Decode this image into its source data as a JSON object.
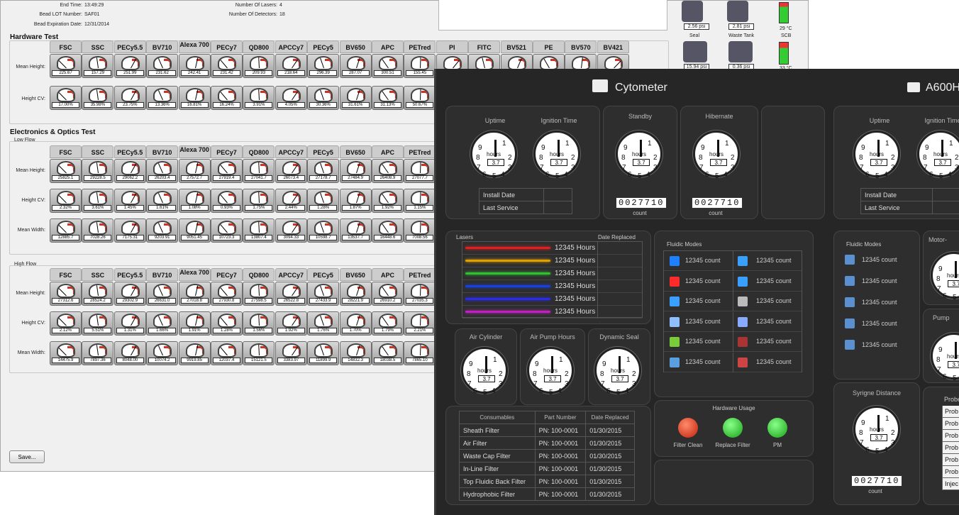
{
  "top": {
    "end_time_label": "End Time:",
    "end_time": "13:49:29",
    "bead_lot_label": "Bead LOT Number:",
    "bead_lot": "SAF01",
    "bead_exp_label": "Bead Expiration Date:",
    "bead_exp": "12/31/2014",
    "lasers_label": "Number Of Lasers:",
    "lasers": "4",
    "detectors_label": "Number Of Detectors:",
    "detectors": "18"
  },
  "side": {
    "psi1": "2.56 psi",
    "psi2": "2.81 psi",
    "temp1": "29 °C",
    "seal": "Seal",
    "waste": "Waste Tank",
    "scb": "SCB",
    "psi3": "15.94 psi",
    "psi4": "0.36 psi",
    "temp2": "33 °C"
  },
  "hardware": {
    "title": "Hardware Test",
    "cols": [
      "FSC",
      "SSC",
      "PECy5.5",
      "BV710",
      "Alexa 700",
      "PECy7",
      "QD800",
      "APCCy7",
      "PECy5",
      "BV650",
      "APC",
      "PETred",
      "PI",
      "FITC",
      "BV521",
      "PE",
      "BV570",
      "BV421"
    ],
    "row_labels": [
      "Mean Height:",
      "Height CV:"
    ],
    "mean_height": [
      "225.67",
      "157.29",
      "251.99",
      "231.62",
      "242.41",
      "231.42",
      "209.93",
      "218.64",
      "296.39",
      "287.07",
      "300.51",
      "155.45"
    ],
    "height_cv": [
      "17.00%",
      "35.98%",
      "23.75%",
      "13.36%",
      "16.81%",
      "16.24%",
      "3.91%",
      "4.05%",
      "30.36%",
      "31.61%",
      "31.13%",
      "50.67%"
    ]
  },
  "eo": {
    "title": "Electronics & Optics Test",
    "low_title": "Low Flow",
    "high_title": "High Flow",
    "cols": [
      "FSC",
      "SSC",
      "PECy5.5",
      "BV710",
      "Alexa 700",
      "PECy7",
      "QD800",
      "APCCy7",
      "PECy5",
      "BV650",
      "APC",
      "PETred"
    ],
    "row_labels": [
      "Mean Height:",
      "Height CV:",
      "Mean Width:"
    ],
    "low_mh": [
      "25825.1",
      "29228.5",
      "29062.2",
      "26203.4",
      "27572.7",
      "27919.4",
      "27041.7",
      "26073.4",
      "27178.7",
      "27484.9",
      "26408.9",
      "27077.7"
    ],
    "low_cv": [
      "2.32%",
      "3.61%",
      "1.45%",
      "1.61%",
      "1.08%",
      "0.93%",
      "1.75%",
      "2.44%",
      "1.28%",
      "1.87%",
      "1.92%",
      "1.15%"
    ],
    "low_mw": [
      "12885.7",
      "7028.26",
      "7175.31",
      "9203.91",
      "9051.45",
      "10723.3",
      "13807.4",
      "3094.33",
      "10598.7",
      "13537.7",
      "16448.6",
      "7008.56"
    ],
    "high_mh": [
      "27312.6",
      "28524.2",
      "29302.9",
      "26631.0",
      "27018.8",
      "27930.8",
      "27598.5",
      "26522.8",
      "27433.9",
      "28221.9",
      "26910.2",
      "27035.3"
    ],
    "high_cv": [
      "2.12%",
      "5.51%",
      "1.31%",
      "1.66%",
      "1.91%",
      "1.28%",
      "1.56%",
      "1.92%",
      "1.76%",
      "1.70%",
      "1.79%",
      "2.21%"
    ],
    "high_mw": [
      "14475.9",
      "7897.36",
      "8048.00",
      "10074.2",
      "9919.85",
      "12037.4",
      "15121.5",
      "3383.97",
      "11899.9",
      "14832.3",
      "18038.5",
      "7865.10"
    ]
  },
  "save_label": "Save...",
  "cytometer": {
    "title": "Cytometer",
    "title2": "A600H",
    "uptime": "Uptime",
    "ignition": "Ignition Time",
    "standby": "Standby",
    "hibernate": "Hibernate",
    "clock_hours": "hours",
    "clock_val": "3.7",
    "install_date": "Install Date",
    "last_service": "Last Service",
    "counter": "0027710",
    "count": "count",
    "lasers_hdr": "Lasers",
    "date_replaced": "Date Replaced",
    "laser_hours": [
      "12345 Hours",
      "12345 Hours",
      "12345 Hours",
      "12345 Hours",
      "12345 Hours",
      "12345 Hours"
    ],
    "fluidic_modes": "Fluidic Modes",
    "mode_counts": [
      "12345 count",
      "12345 count",
      "12345 count",
      "12345 count",
      "12345 count",
      "12345 count"
    ],
    "mode_counts2": [
      "12345 count",
      "12345 count",
      "12345 count",
      "12345 count",
      "12345 count",
      "12345 count"
    ],
    "air_cyl": "Air Cylinder",
    "air_pump": "Air Pump Hours",
    "dyn_seal": "Dynamic Seal",
    "hw_usage": "Hardware Usage",
    "filter_clean": "Filter Clean",
    "replace_filter": "Replace Filter",
    "pm": "PM",
    "cons_hdr": [
      "Consumables",
      "Part Number",
      "Date Replaced"
    ],
    "consumables": [
      [
        "Sheath Filter",
        "PN: 100-0001",
        "01/30/2015"
      ],
      [
        "Air Filter",
        "PN: 100-0001",
        "01/30/2015"
      ],
      [
        "Waste Cap Filter",
        "PN: 100-0001",
        "01/30/2015"
      ],
      [
        "In-Line Filter",
        "PN: 100-0001",
        "01/30/2015"
      ],
      [
        "Top Fluidic Back Filter",
        "PN: 100-0001",
        "01/30/2015"
      ],
      [
        "Hydrophobic Filter",
        "PN: 100-0001",
        "01/30/2015"
      ]
    ],
    "r_fluidic": "Fluidic Modes",
    "r_counts": [
      "12345 count",
      "12345 count",
      "12345 count",
      "12345 count",
      "12345 count"
    ],
    "motor": "Motor-",
    "pump": "Pump",
    "syringe": "Syrigne Distance",
    "probe": [
      "Probe",
      "Prob",
      "Prob",
      "Prob",
      "Prob",
      "Prob",
      "Prob",
      "Injec"
    ]
  }
}
